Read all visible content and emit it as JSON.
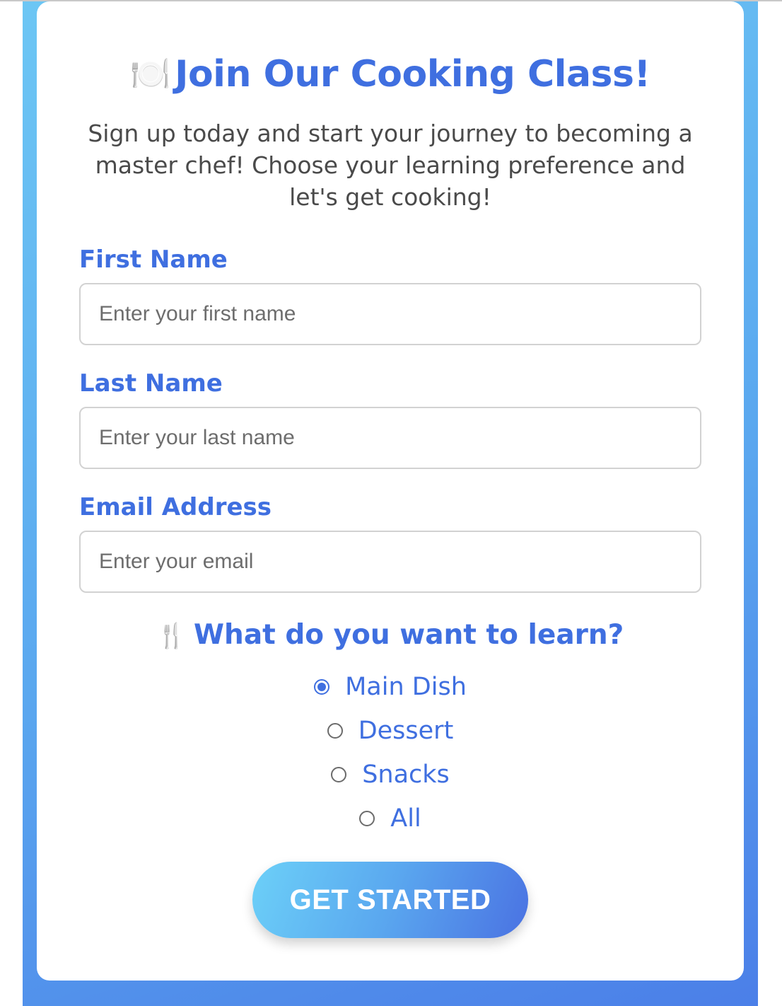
{
  "header": {
    "icon": "plate-with-cutlery-icon",
    "emoji": "🍽️",
    "title": "Join Our Cooking Class!",
    "subtitle": "Sign up today and start your journey to becoming a master chef! Choose your learning preference and let's get cooking!"
  },
  "form": {
    "first_name": {
      "label": "First Name",
      "placeholder": "Enter your first name",
      "value": ""
    },
    "last_name": {
      "label": "Last Name",
      "placeholder": "Enter your last name",
      "value": ""
    },
    "email": {
      "label": "Email Address",
      "placeholder": "Enter your email",
      "value": ""
    }
  },
  "learning": {
    "icon": "fork-and-knife-icon",
    "emoji": "🍴",
    "heading": "What do you want to learn?",
    "options": [
      {
        "label": "Main Dish",
        "checked": true
      },
      {
        "label": "Dessert",
        "checked": false
      },
      {
        "label": "Snacks",
        "checked": false
      },
      {
        "label": "All",
        "checked": false
      }
    ],
    "selected": "Main Dish"
  },
  "submit": {
    "label": "GET STARTED"
  },
  "colors": {
    "accent": "#3f6fe0",
    "gradient_start": "#6cc6f4",
    "gradient_end": "#4b7fe8",
    "text_body": "#4a4a4a"
  }
}
